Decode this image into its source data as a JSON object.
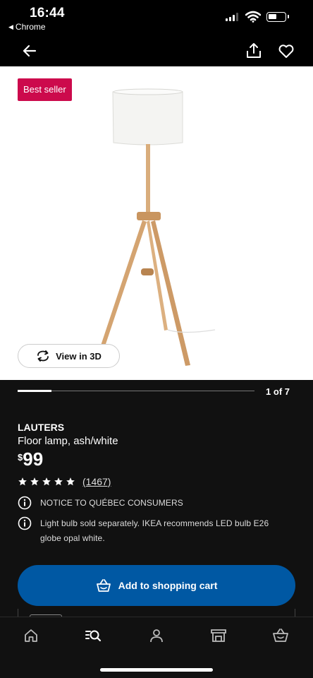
{
  "status_bar": {
    "time": "16:44",
    "back_app": "Chrome",
    "icons": [
      "signal-icon",
      "wifi-icon",
      "battery-icon"
    ]
  },
  "nav": {
    "icons": [
      "back-arrow-icon",
      "share-icon",
      "heart-icon"
    ]
  },
  "gallery": {
    "badge": "Best seller",
    "view_3d_label": "View in 3D",
    "page_indicator": "1 of 7",
    "current_image": 1,
    "total_images": 7
  },
  "product": {
    "name": "LAUTERS",
    "description": "Floor lamp, ash/white",
    "currency_symbol": "$",
    "price": "99",
    "rating_stars": 5,
    "review_count": "(1467)"
  },
  "notices": {
    "quebec": "NOTICE TO QUÉBEC CONSUMERS",
    "bulb_line1": "Light bulb sold separately. IKEA recommends LED bulb E26",
    "bulb_line2": "globe opal white."
  },
  "actions": {
    "add_to_cart": "Add to shopping cart"
  },
  "tab_bar": {
    "items": [
      "home-icon",
      "search-list-icon",
      "profile-icon",
      "store-icon",
      "basket-icon"
    ]
  },
  "colors": {
    "background": "#111111",
    "badge": "#cc0a4c",
    "cta": "#0058a3"
  }
}
